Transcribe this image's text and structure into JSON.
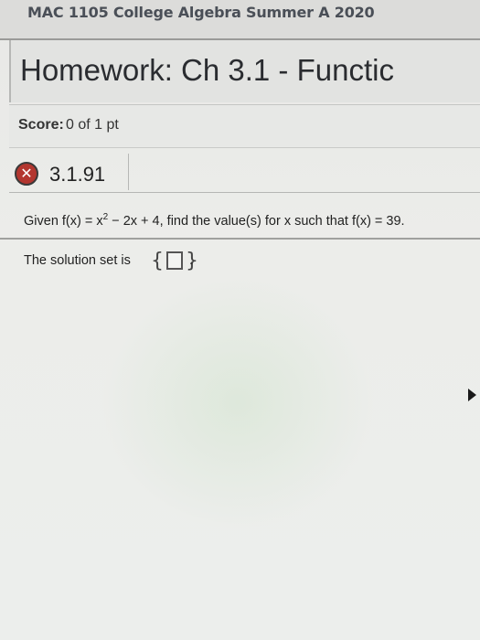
{
  "course": {
    "title": "MAC 1105 College Algebra Summer A 2020"
  },
  "homework": {
    "title": "Homework: Ch 3.1 - Functic"
  },
  "score": {
    "label": "Score:",
    "value": "0 of 1 pt"
  },
  "problem": {
    "id": "3.1.91",
    "status_icon": "x-circle-icon",
    "status_color": "#b3362f"
  },
  "question": {
    "prefix": "Given f(x) = x",
    "exponent": "2",
    "suffix": " − 2x + 4, find the value(s) for x such that f(x) = 39."
  },
  "solution": {
    "label": "The solution set is",
    "open_brace": "{",
    "close_brace": "}",
    "end": "."
  }
}
